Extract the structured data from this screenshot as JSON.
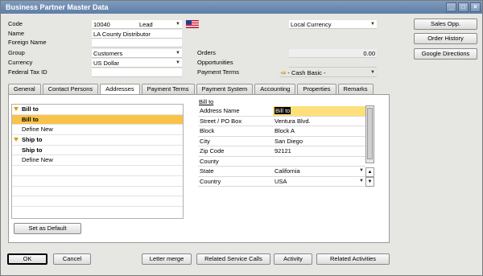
{
  "window": {
    "title": "Business Partner Master Data"
  },
  "header": {
    "code_label": "Code",
    "code_value": "10040",
    "code_type": "Lead",
    "name_label": "Name",
    "name_value": "LA County Distributor",
    "foreign_name_label": "Foreign Name",
    "foreign_name_value": "",
    "group_label": "Group",
    "group_value": "Customers",
    "currency_label": "Currency",
    "currency_value": "US Dollar",
    "federal_tax_label": "Federal Tax ID",
    "federal_tax_value": "",
    "local_currency": "Local Currency",
    "orders_label": "Orders",
    "orders_value": "0.00",
    "opportunities_label": "Opportunities",
    "opportunities_value": "",
    "payment_terms_label": "Payment Terms",
    "payment_terms_value": "- Cash Basic -"
  },
  "side_buttons": {
    "sales_opp": "Sales Opp.",
    "order_history": "Order History",
    "google_directions": "Google Directions"
  },
  "tabs": [
    {
      "label": "General"
    },
    {
      "label": "Contact Persons"
    },
    {
      "label": "Addresses"
    },
    {
      "label": "Payment Terms"
    },
    {
      "label": "Payment System"
    },
    {
      "label": "Accounting"
    },
    {
      "label": "Properties"
    },
    {
      "label": "Remarks"
    }
  ],
  "address_list": [
    {
      "label": "Bill to"
    },
    {
      "label": "Bill to"
    },
    {
      "label": "Define New"
    },
    {
      "label": "Ship to"
    },
    {
      "label": "Ship to"
    },
    {
      "label": "Define New"
    }
  ],
  "address_section": {
    "title": "Bill to"
  },
  "address_fields": [
    {
      "label": "Address Name",
      "value": "Bill to"
    },
    {
      "label": "Street / PO Box",
      "value": "Ventura Blvd."
    },
    {
      "label": "Block",
      "value": "Block A"
    },
    {
      "label": "City",
      "value": "San Diego"
    },
    {
      "label": "Zip Code",
      "value": "92121"
    },
    {
      "label": "County",
      "value": ""
    },
    {
      "label": "State",
      "value": "California"
    },
    {
      "label": "Country",
      "value": "USA"
    }
  ],
  "buttons": {
    "set_default": "Set as Default",
    "ok": "OK",
    "cancel": "Cancel",
    "letter_merge": "Letter merge",
    "related_calls": "Related Service Calls",
    "activity": "Activity",
    "related_activities": "Related Activities"
  },
  "colors": {
    "selection": "#f9c34a",
    "titlebar": "#6b88ae"
  },
  "icons": {
    "minimize": "minimize-icon",
    "maximize": "maximize-icon",
    "close": "close-icon",
    "flag": "us-flag-icon",
    "link_arrow": "orange-link-arrow-icon"
  }
}
